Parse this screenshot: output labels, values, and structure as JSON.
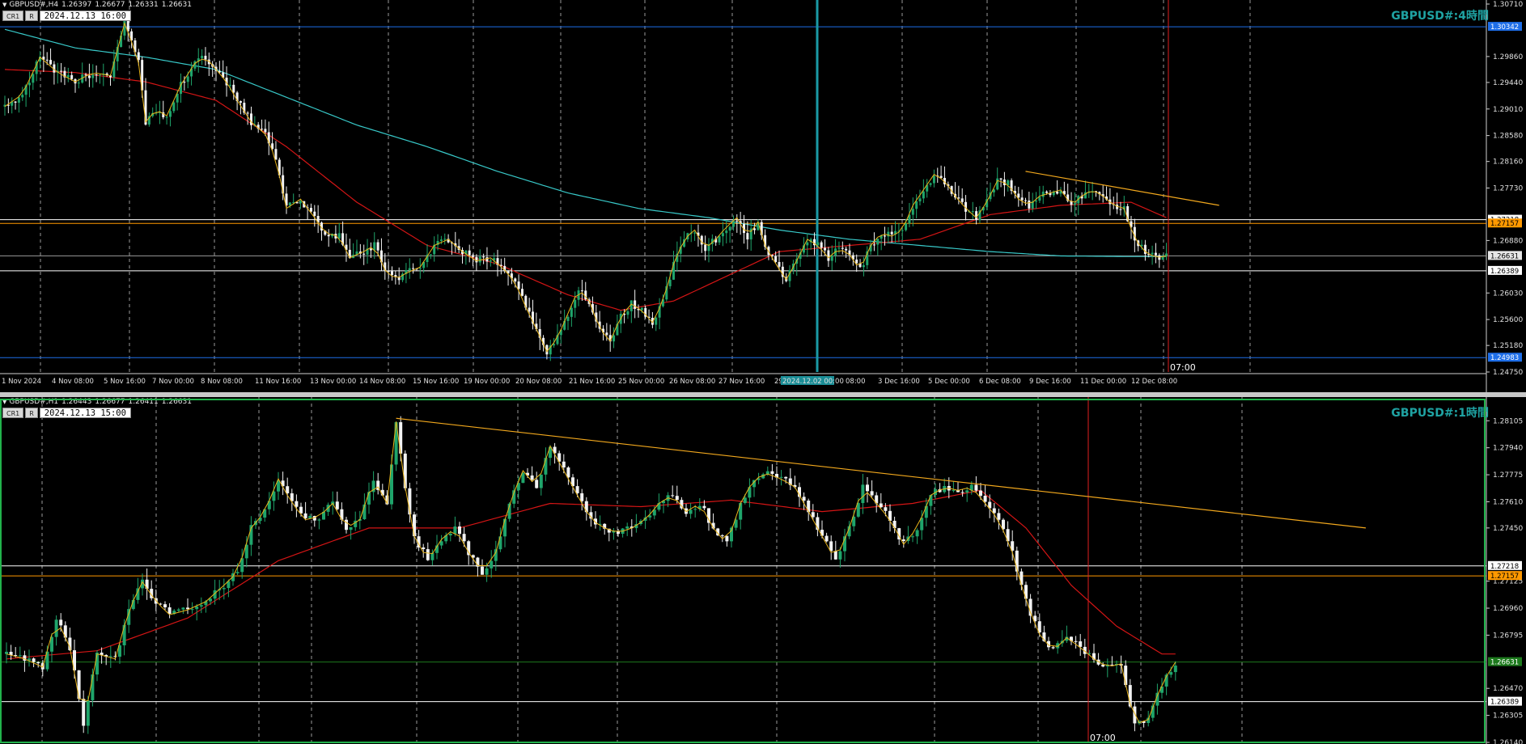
{
  "chart_data": [
    {
      "type": "candlestick",
      "symbol": "GBPUSD#,H4",
      "header_values": [
        "1.26397",
        "1.26677",
        "1.26331",
        "1.26631"
      ],
      "buttons": [
        "CR1",
        "R"
      ],
      "datetime": "2024.12.13 16:00",
      "timeframe_label": "GBPUSD#:4時間",
      "ylim": [
        1.2475,
        1.3071
      ],
      "price_ticks": [
        "1.30710",
        "1.29860",
        "1.29440",
        "1.29010",
        "1.28580",
        "1.28160",
        "1.27730",
        "1.26880",
        "1.26030",
        "1.25600",
        "1.25180",
        "1.24750"
      ],
      "levels": [
        {
          "label": "1.30342",
          "value": 1.30342,
          "color": "#1e6ee8",
          "box": "#1e6ee8"
        },
        {
          "label": "1.27218",
          "value": 1.27218,
          "color": "#ffffff",
          "box": "#ffffff"
        },
        {
          "label": "1.27157",
          "value": 1.27157,
          "color": "#ff9900",
          "box": "#ff9900"
        },
        {
          "label": "1.26631",
          "value": 1.26631,
          "color": "#999999",
          "box": "#e6e6e6"
        },
        {
          "label": "1.26389",
          "value": 1.26389,
          "color": "#ffffff",
          "box": "#ffffff"
        },
        {
          "label": "1.24983",
          "value": 1.24983,
          "color": "#1e6ee8",
          "box": "#1e6ee8"
        }
      ],
      "time_labels": [
        "1 Nov 2024",
        "4 Nov 08:00",
        "5 Nov 16:00",
        "7 Nov 00:00",
        "8 Nov 08:00",
        "11 Nov 16:00",
        "13 Nov 00:00",
        "14 Nov 08:00",
        "15 Nov 16:00",
        "19 Nov 00:00",
        "20 Nov 08:00",
        "21 Nov 16:00",
        "25 Nov 00:00",
        "26 Nov 08:00",
        "27 Nov 16:00",
        "29",
        "2024.12.02 00:00",
        "08:00",
        "3 Dec 16:00",
        "5 Dec 00:00",
        "6 Dec 08:00",
        "9 Dec 16:00",
        "11 Dec 00:00",
        "12 Dec 08:00"
      ],
      "vline_label": "07:00",
      "close_path": [
        [
          0,
          1.2905
        ],
        [
          5,
          1.2925
        ],
        [
          10,
          1.2985
        ],
        [
          15,
          1.296
        ],
        [
          20,
          1.2945
        ],
        [
          25,
          1.296
        ],
        [
          30,
          1.2955
        ],
        [
          34,
          1.304
        ],
        [
          36,
          1.301
        ],
        [
          38,
          1.2975
        ],
        [
          40,
          1.288
        ],
        [
          43,
          1.29
        ],
        [
          46,
          1.289
        ],
        [
          50,
          1.294
        ],
        [
          54,
          1.2975
        ],
        [
          57,
          1.2985
        ],
        [
          60,
          1.2965
        ],
        [
          63,
          1.2945
        ],
        [
          66,
          1.2915
        ],
        [
          70,
          1.288
        ],
        [
          74,
          1.286
        ],
        [
          77,
          1.282
        ],
        [
          80,
          1.274
        ],
        [
          84,
          1.2755
        ],
        [
          88,
          1.2725
        ],
        [
          91,
          1.27
        ],
        [
          95,
          1.2695
        ],
        [
          98,
          1.266
        ],
        [
          102,
          1.267
        ],
        [
          105,
          1.268
        ],
        [
          108,
          1.264
        ],
        [
          111,
          1.2625
        ],
        [
          114,
          1.2635
        ],
        [
          118,
          1.2645
        ],
        [
          122,
          1.268
        ],
        [
          126,
          1.269
        ],
        [
          130,
          1.267
        ],
        [
          134,
          1.2655
        ],
        [
          138,
          1.266
        ],
        [
          142,
          1.264
        ],
        [
          145,
          1.262
        ],
        [
          148,
          1.258
        ],
        [
          151,
          1.2545
        ],
        [
          154,
          1.2508
        ],
        [
          157,
          1.253
        ],
        [
          160,
          1.257
        ],
        [
          163,
          1.261
        ],
        [
          166,
          1.259
        ],
        [
          169,
          1.2545
        ],
        [
          172,
          1.2525
        ],
        [
          175,
          1.2565
        ],
        [
          178,
          1.2585
        ],
        [
          181,
          1.2575
        ],
        [
          184,
          1.2555
        ],
        [
          187,
          1.259
        ],
        [
          190,
          1.265
        ],
        [
          193,
          1.269
        ],
        [
          196,
          1.2705
        ],
        [
          199,
          1.2675
        ],
        [
          202,
          1.269
        ],
        [
          205,
          1.271
        ],
        [
          208,
          1.2725
        ],
        [
          211,
          1.2695
        ],
        [
          214,
          1.2718
        ],
        [
          216,
          1.268
        ],
        [
          219,
          1.265
        ],
        [
          222,
          1.2625
        ],
        [
          225,
          1.2655
        ],
        [
          228,
          1.269
        ],
        [
          231,
          1.268
        ],
        [
          234,
          1.266
        ],
        [
          237,
          1.2675
        ],
        [
          240,
          1.2665
        ],
        [
          243,
          1.264
        ],
        [
          246,
          1.268
        ],
        [
          249,
          1.27
        ],
        [
          252,
          1.2695
        ],
        [
          255,
          1.2705
        ],
        [
          258,
          1.2745
        ],
        [
          261,
          1.277
        ],
        [
          264,
          1.2795
        ],
        [
          267,
          1.2785
        ],
        [
          270,
          1.276
        ],
        [
          273,
          1.274
        ],
        [
          276,
          1.2725
        ],
        [
          279,
          1.275
        ],
        [
          282,
          1.2785
        ],
        [
          285,
          1.278
        ],
        [
          288,
          1.2755
        ],
        [
          291,
          1.2745
        ],
        [
          294,
          1.276
        ],
        [
          297,
          1.2765
        ],
        [
          300,
          1.277
        ],
        [
          303,
          1.2745
        ],
        [
          306,
          1.276
        ],
        [
          309,
          1.277
        ],
        [
          312,
          1.276
        ],
        [
          315,
          1.2745
        ],
        [
          318,
          1.274
        ],
        [
          321,
          1.269
        ],
        [
          324,
          1.267
        ],
        [
          327,
          1.266
        ],
        [
          330,
          1.2663
        ]
      ],
      "ma_red": [
        [
          0,
          1.2965
        ],
        [
          20,
          1.296
        ],
        [
          40,
          1.2945
        ],
        [
          60,
          1.2915
        ],
        [
          80,
          1.284
        ],
        [
          100,
          1.275
        ],
        [
          120,
          1.268
        ],
        [
          140,
          1.265
        ],
        [
          160,
          1.26
        ],
        [
          175,
          1.2575
        ],
        [
          190,
          1.259
        ],
        [
          205,
          1.263
        ],
        [
          220,
          1.267
        ],
        [
          240,
          1.268
        ],
        [
          260,
          1.269
        ],
        [
          280,
          1.273
        ],
        [
          300,
          1.2745
        ],
        [
          320,
          1.275
        ],
        [
          330,
          1.2725
        ]
      ],
      "ma_cyan": [
        [
          0,
          1.303
        ],
        [
          20,
          1.3
        ],
        [
          40,
          1.2985
        ],
        [
          60,
          1.2965
        ],
        [
          80,
          1.292
        ],
        [
          100,
          1.2875
        ],
        [
          120,
          1.284
        ],
        [
          140,
          1.28
        ],
        [
          160,
          1.2765
        ],
        [
          180,
          1.274
        ],
        [
          200,
          1.2725
        ],
        [
          220,
          1.2705
        ],
        [
          240,
          1.269
        ],
        [
          260,
          1.268
        ],
        [
          280,
          1.267
        ],
        [
          300,
          1.2663
        ],
        [
          320,
          1.2662
        ],
        [
          330,
          1.2662
        ]
      ],
      "trendline": {
        "from": [
          290,
          1.28
        ],
        "to": [
          345,
          1.2745
        ]
      }
    },
    {
      "type": "candlestick",
      "symbol": "GBPUSD#,H1",
      "header_values": [
        "1.26443",
        "1.26677",
        "1.26411",
        "1.26631"
      ],
      "buttons": [
        "CR1",
        "R"
      ],
      "datetime": "2024.12.13 15:00",
      "timeframe_label": "GBPUSD#:1時間",
      "ylim": [
        1.2614,
        1.2822
      ],
      "price_ticks": [
        "1.28105",
        "1.27940",
        "1.27775",
        "1.27610",
        "1.27450",
        "1.27125",
        "1.26960",
        "1.26795",
        "1.26470",
        "1.26305",
        "1.26140"
      ],
      "levels": [
        {
          "label": "1.27218",
          "value": 1.27218,
          "color": "#ffffff",
          "box": "#ffffff"
        },
        {
          "label": "1.27157",
          "value": 1.27157,
          "color": "#ff9900",
          "box": "#ff9900"
        },
        {
          "label": "1.26631",
          "value": 1.26631,
          "color": "#1d7a1d",
          "box": "#1d7a1d"
        },
        {
          "label": "1.26389",
          "value": 1.26389,
          "color": "#ffffff",
          "box": "#ffffff"
        }
      ],
      "vline_label": "07:00",
      "close_path": [
        [
          0,
          1.2668
        ],
        [
          4,
          1.2665
        ],
        [
          8,
          1.266
        ],
        [
          11,
          1.269
        ],
        [
          14,
          1.2672
        ],
        [
          17,
          1.2625
        ],
        [
          20,
          1.2668
        ],
        [
          24,
          1.2665
        ],
        [
          27,
          1.2695
        ],
        [
          30,
          1.2712
        ],
        [
          33,
          1.27
        ],
        [
          36,
          1.2692
        ],
        [
          40,
          1.2695
        ],
        [
          44,
          1.27
        ],
        [
          48,
          1.271
        ],
        [
          51,
          1.2718
        ],
        [
          54,
          1.2745
        ],
        [
          57,
          1.2755
        ],
        [
          60,
          1.2775
        ],
        [
          63,
          1.276
        ],
        [
          66,
          1.275
        ],
        [
          69,
          1.2752
        ],
        [
          72,
          1.276
        ],
        [
          75,
          1.2745
        ],
        [
          78,
          1.275
        ],
        [
          81,
          1.2775
        ],
        [
          84,
          1.276
        ],
        [
          86,
          1.281
        ],
        [
          88,
          1.277
        ],
        [
          90,
          1.274
        ],
        [
          93,
          1.2725
        ],
        [
          96,
          1.2738
        ],
        [
          99,
          1.2745
        ],
        [
          102,
          1.273
        ],
        [
          105,
          1.2718
        ],
        [
          108,
          1.273
        ],
        [
          111,
          1.276
        ],
        [
          114,
          1.278
        ],
        [
          117,
          1.277
        ],
        [
          120,
          1.2795
        ],
        [
          123,
          1.278
        ],
        [
          126,
          1.2765
        ],
        [
          129,
          1.275
        ],
        [
          132,
          1.2745
        ],
        [
          135,
          1.2742
        ],
        [
          138,
          1.2745
        ],
        [
          141,
          1.275
        ],
        [
          144,
          1.276
        ],
        [
          147,
          1.2765
        ],
        [
          150,
          1.2755
        ],
        [
          153,
          1.276
        ],
        [
          156,
          1.2745
        ],
        [
          159,
          1.2735
        ],
        [
          162,
          1.276
        ],
        [
          165,
          1.2775
        ],
        [
          168,
          1.2778
        ],
        [
          171,
          1.2775
        ],
        [
          174,
          1.277
        ],
        [
          177,
          1.2755
        ],
        [
          180,
          1.274
        ],
        [
          183,
          1.2725
        ],
        [
          186,
          1.2745
        ],
        [
          189,
          1.277
        ],
        [
          192,
          1.276
        ],
        [
          195,
          1.275
        ],
        [
          198,
          1.2735
        ],
        [
          201,
          1.2745
        ],
        [
          204,
          1.2765
        ],
        [
          207,
          1.277
        ],
        [
          210,
          1.2768
        ],
        [
          213,
          1.277
        ],
        [
          216,
          1.276
        ],
        [
          219,
          1.275
        ],
        [
          222,
          1.273
        ],
        [
          225,
          1.27
        ],
        [
          228,
          1.268
        ],
        [
          231,
          1.267
        ],
        [
          234,
          1.2678
        ],
        [
          237,
          1.2672
        ],
        [
          240,
          1.2665
        ],
        [
          243,
          1.266
        ],
        [
          246,
          1.2662
        ],
        [
          249,
          1.2625
        ],
        [
          252,
          1.2628
        ],
        [
          255,
          1.265
        ],
        [
          258,
          1.2663
        ]
      ],
      "ma_red": [
        [
          0,
          1.2665
        ],
        [
          20,
          1.267
        ],
        [
          40,
          1.269
        ],
        [
          60,
          1.2725
        ],
        [
          80,
          1.2745
        ],
        [
          100,
          1.2745
        ],
        [
          120,
          1.276
        ],
        [
          140,
          1.2758
        ],
        [
          160,
          1.2762
        ],
        [
          180,
          1.2755
        ],
        [
          200,
          1.276
        ],
        [
          215,
          1.2768
        ],
        [
          225,
          1.2745
        ],
        [
          235,
          1.271
        ],
        [
          245,
          1.2685
        ],
        [
          255,
          1.2668
        ]
      ],
      "trendline": {
        "from": [
          86,
          1.2812
        ],
        "to": [
          300,
          1.2745
        ]
      }
    }
  ]
}
